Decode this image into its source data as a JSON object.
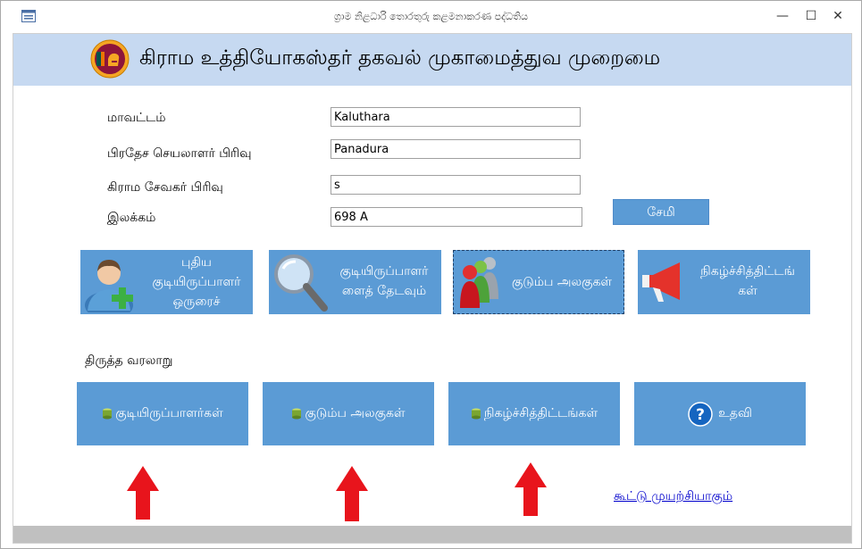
{
  "window": {
    "title": "ග්‍රාම නිළධාරි තොරතුරු කළමනාකරණ පද්ධතිය",
    "controls": {
      "minimize": "—",
      "maximize": "☐",
      "close": "✕"
    }
  },
  "header": {
    "title": "கிராம உத்தியோகஸ்தர் தகவல் முகாமைத்துவ முறைமை"
  },
  "form": {
    "district_label": "மாவட்டம்",
    "district_value": "Kaluthara",
    "ds_label": "பிரதேச செயலாளர் பிரிவு",
    "ds_value": "Panadura",
    "gn_label": "கிராம சேவகர் பிரிவு",
    "gn_value": "s",
    "number_label": "இலக்கம்",
    "number_value": "698 A",
    "save_label": "சேமி"
  },
  "tiles": {
    "new_resident": {
      "line1": "புதிய",
      "line2": "குடியிருப்பாளர்",
      "line3": "ஒருரைச்"
    },
    "search_resident": {
      "line1": "குடியிருப்பாளர்",
      "line2": "ளைத் தேடவும்"
    },
    "family_units": {
      "label": "குடும்ப அலகுகள்"
    },
    "events": {
      "line1": "நிகழ்ச்சித்திட்டங்",
      "line2": "கள்"
    }
  },
  "history": {
    "section_label": "திருத்த வரலாறு",
    "residents": "குடியிருப்பாளர்கள்",
    "family_units": "குடும்ப அலகுகள்",
    "events": "நிகழ்ச்சித்திட்டங்கள்",
    "help": "உதவி"
  },
  "footer": {
    "link": "கூட்டு முயற்சியாகும்"
  },
  "colors": {
    "tile": "#5b9bd5",
    "header_band": "#c6d9f1",
    "arrow": "#e8141c",
    "link": "#0000cc"
  }
}
